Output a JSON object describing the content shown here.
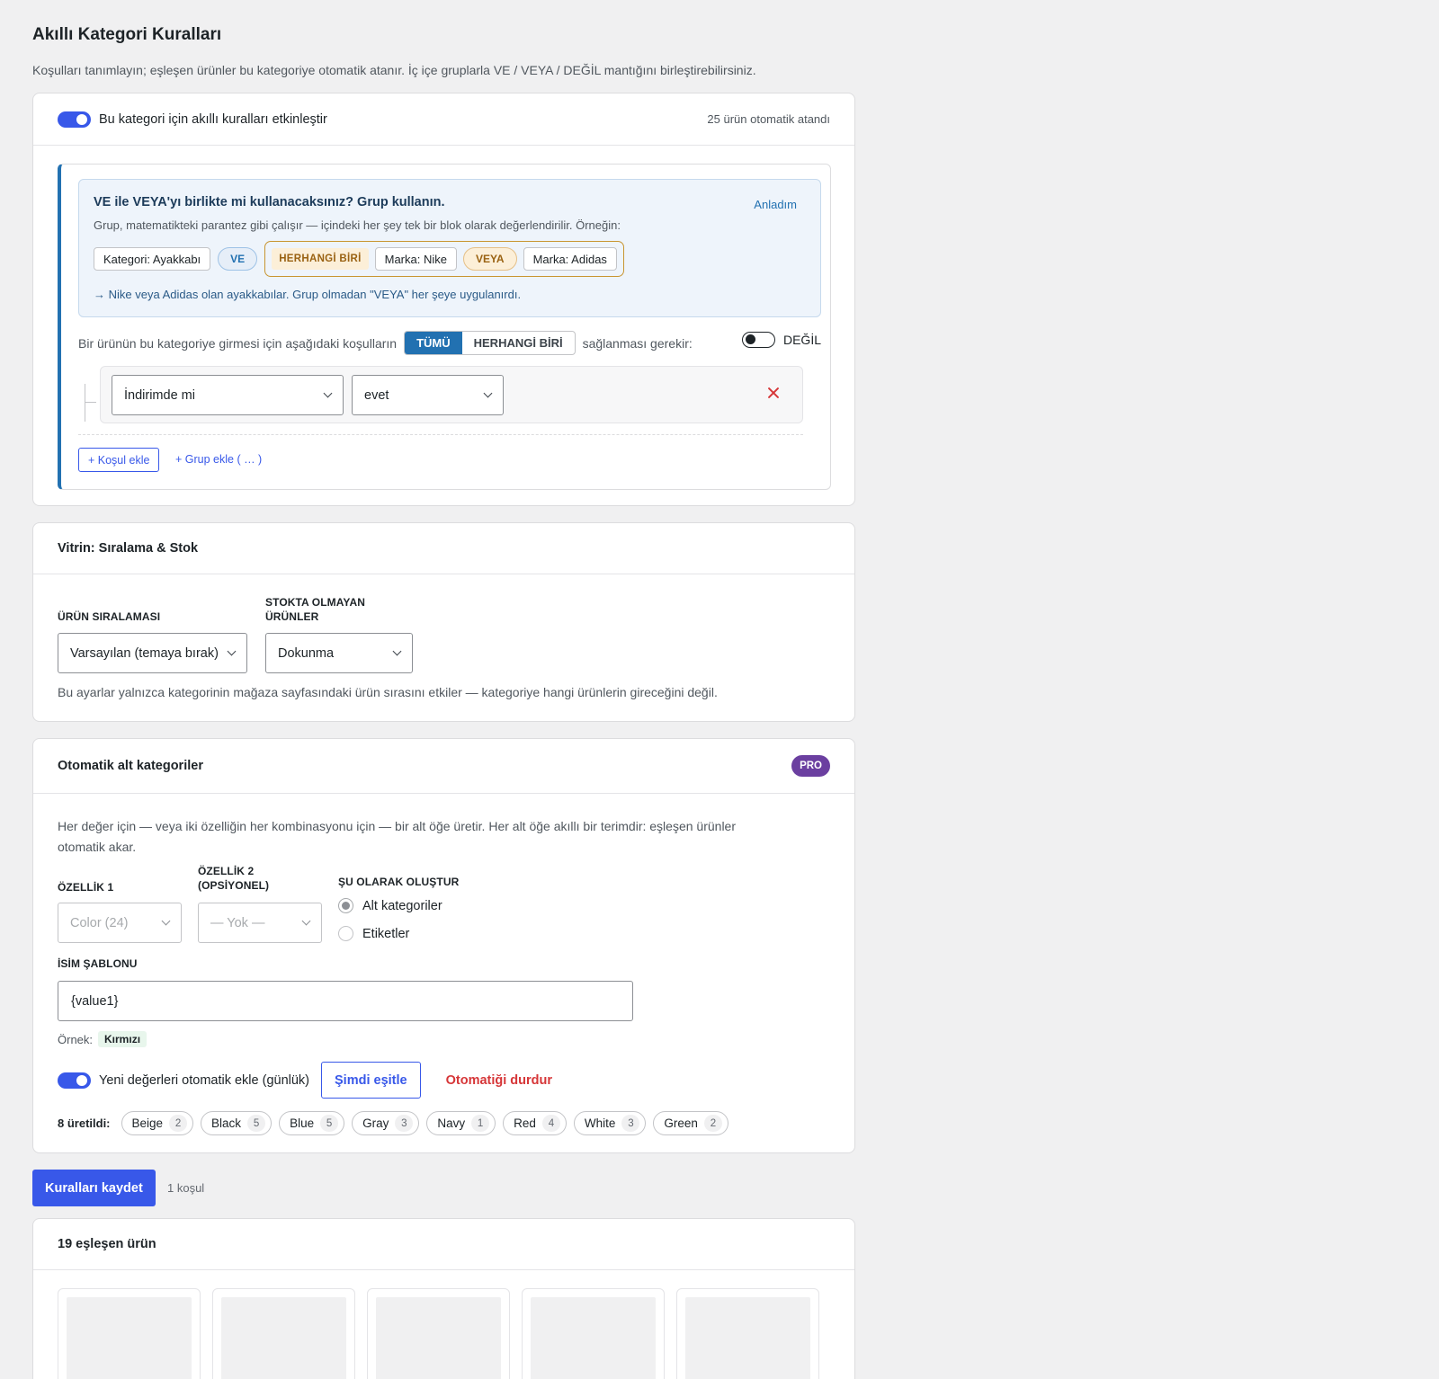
{
  "header": {
    "title": "Akıllı Kategori Kuralları",
    "intro": "Koşulları tanımlayın; eşleşen ürünler bu kategoriye otomatik atanır. İç içe gruplarla VE / VEYA / DEĞİL mantığını birleştirebilirsiniz."
  },
  "rules": {
    "enable_label": "Bu kategori için akıllı kuralları etkinleştir",
    "assigned_count": "25 ürün otomatik atandı",
    "help": {
      "title": "VE ile VEYA'yı birlikte mi kullanacaksınız? Grup kullanın.",
      "dismiss": "Anladım",
      "text": "Grup, matematikteki parantez gibi çalışır — içindeki her şey tek bir blok olarak değerlendirilir. Örneğin:",
      "example": {
        "chip1": "Kategori: Ayakkabı",
        "and": "VE",
        "any": "HERHANGİ BİRİ",
        "chip2": "Marka: Nike",
        "or": "VEYA",
        "chip3": "Marka: Adidas"
      },
      "note": "→ Nike veya Adidas olan ayakkabılar. Grup olmadan \"VEYA\" her şeye uygulanırdı."
    },
    "match_prefix": "Bir ürünün bu kategoriye girmesi için aşağıdaki koşulların",
    "match_all": "TÜMÜ",
    "match_any": "HERHANGİ BİRİ",
    "match_suffix": "sağlanması gerekir:",
    "not_label": "DEĞİL",
    "condition": {
      "field": "İndirimde mi",
      "value": "evet"
    },
    "add_condition": "+ Koşul ekle",
    "add_group": "+ Grup ekle ( … )"
  },
  "storefront": {
    "title": "Vitrin: Sıralama & Stok",
    "sort_label": "ÜRÜN SIRALAMASI",
    "sort_value": "Varsayılan (temaya bırak)",
    "stock_label_1": "STOKTA OLMAYAN",
    "stock_label_2": "ÜRÜNLER",
    "stock_value": "Dokunma",
    "hint": "Bu ayarlar yalnızca kategorinin mağaza sayfasındaki ürün sırasını etkiler — kategoriye hangi ürünlerin gireceğini değil."
  },
  "auto_sub": {
    "title": "Otomatik alt kategoriler",
    "badge": "PRO",
    "desc_1": "Her değer için — veya iki özelliğin her kombinasyonu için — bir alt öğe üretir. Her alt öğe akıllı bir terimdir: eşleşen ürünler",
    "desc_2": "otomatik akar.",
    "attr1_label": "ÖZELLİK 1",
    "attr1_value": "Color (24)",
    "attr2_label_1": "ÖZELLİK 2",
    "attr2_label_2": "(OPSİYONEL)",
    "attr2_value": "— Yok —",
    "create_as_label": "ŞU OLARAK OLUŞTUR",
    "opt_sub": "Alt kategoriler",
    "opt_tags": "Etiketler",
    "name_label": "İSİM ŞABLONU",
    "name_value": "{value1}",
    "example_label": "Örnek:",
    "example_value": "Kırmızı",
    "auto_add_label": "Yeni değerleri otomatik ekle (günlük)",
    "sync_now": "Şimdi eşitle",
    "stop_auto": "Otomatiği durdur",
    "generated_label": "8 üretildi:",
    "generated": [
      {
        "name": "Beige",
        "count": "2"
      },
      {
        "name": "Black",
        "count": "5"
      },
      {
        "name": "Blue",
        "count": "5"
      },
      {
        "name": "Gray",
        "count": "3"
      },
      {
        "name": "Navy",
        "count": "1"
      },
      {
        "name": "Red",
        "count": "4"
      },
      {
        "name": "White",
        "count": "3"
      },
      {
        "name": "Green",
        "count": "2"
      }
    ]
  },
  "save": {
    "label": "Kuralları kaydet",
    "meta": "1 koşul"
  },
  "matches": {
    "title": "19 eşleşen ürün"
  },
  "colors": {
    "accent": "#3858e9",
    "group_border": "#2271b1",
    "danger": "#d63638",
    "pro": "#6b3fa0"
  }
}
